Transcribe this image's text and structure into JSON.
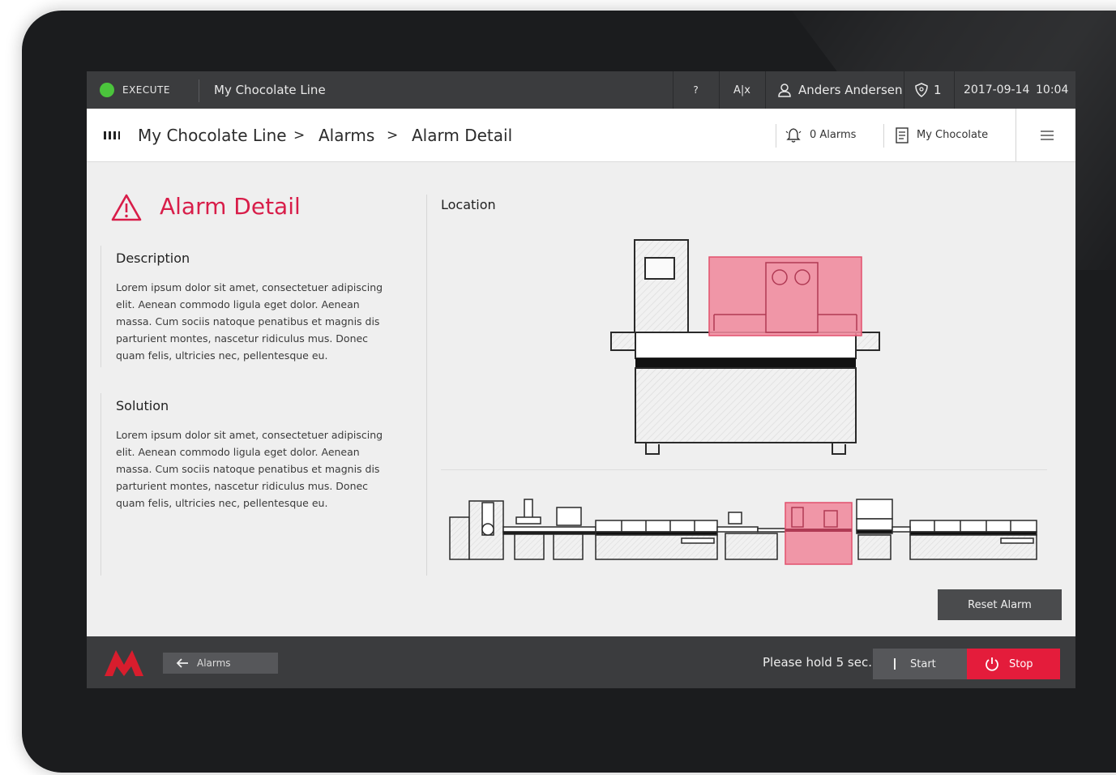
{
  "topbar": {
    "status_label": "EXECUTE",
    "line_name": "My Chocolate Line",
    "help_label": "?",
    "lang_label": "A|x",
    "user_name": "Anders Andersen",
    "shield_count": "1",
    "date": "2017-09-14",
    "time": "10:04"
  },
  "breadcrumb": {
    "items": [
      "My Chocolate Line",
      "Alarms",
      "Alarm Detail"
    ],
    "separator": ">",
    "alarms_count": "0 Alarms",
    "recipe": "My Chocolate"
  },
  "detail": {
    "title": "Alarm Detail",
    "description_heading": "Description",
    "description_lines": [
      "Lorem ipsum dolor sit amet, consectetuer adipiscing",
      "elit. Aenean commodo ligula eget dolor. Aenean",
      "massa. Cum sociis natoque penatibus et magnis dis",
      "parturient montes, nascetur ridiculus mus. Donec",
      "quam felis, ultricies nec, pellentesque eu."
    ],
    "solution_heading": "Solution",
    "solution_lines": [
      "Lorem ipsum dolor sit amet, consectetuer adipiscing",
      "elit. Aenean commodo ligula eget dolor. Aenean",
      "massa. Cum sociis natoque penatibus et magnis dis",
      "parturient montes, nascetur ridiculus mus. Donec",
      "quam felis, ultricies nec, pellentesque eu."
    ],
    "location_label": "Location",
    "reset_label": "Reset Alarm"
  },
  "bottombar": {
    "back_label": "Alarms",
    "hold_text": "Please hold 5 sec.",
    "start_label": "Start",
    "stop_label": "Stop"
  },
  "colors": {
    "alarm_red": "#d81d49",
    "highlight_pink": "#f08a9d",
    "status_green": "#4bc43c",
    "stop_red": "#e41c3b",
    "bar_dark": "#3b3c3e"
  },
  "icons": {
    "status": "status-dot-icon",
    "user": "user-icon",
    "shield": "shield-icon",
    "menu": "bars-icon",
    "bell": "bell-icon",
    "document": "document-icon",
    "hamburger": "hamburger-icon",
    "warning": "warning-icon",
    "back": "arrow-left-icon",
    "power": "power-icon",
    "logo": "brand-logo"
  }
}
